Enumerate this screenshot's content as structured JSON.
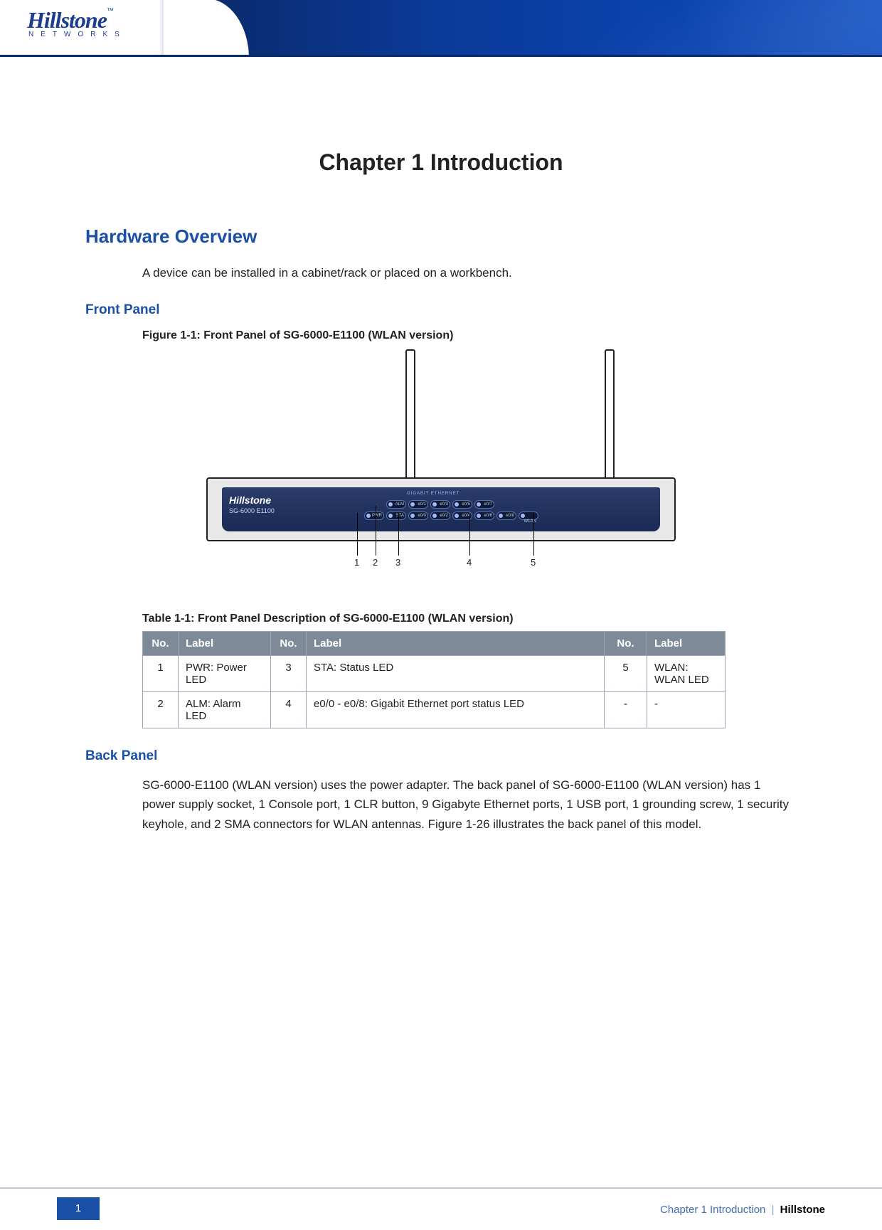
{
  "header": {
    "logo_word": "Hillstone",
    "logo_tm": "™",
    "logo_sub": "NETWORKS"
  },
  "main": {
    "chapter_title": "Chapter 1 Introduction",
    "h2_hardware": "Hardware Overview",
    "intro_text": "A device can be installed in a cabinet/rack or placed on a workbench.",
    "h3_front": "Front Panel",
    "fig_caption": "Figure 1-1: Front Panel of SG-6000-E1100 (WLAN version)",
    "device": {
      "brand": "Hillstone",
      "model_line": "SG-6000   E1100",
      "row1": [
        "ALM",
        "e0/1",
        "e0/3",
        "e0/5",
        "e0/7"
      ],
      "row2": [
        "PWR",
        "STA",
        "e0/0",
        "e0/2",
        "e0/4",
        "e0/6",
        "e0/8",
        "WLAN"
      ],
      "led_header": "GIGABIT ETHERNET",
      "callouts": [
        "1",
        "2",
        "3",
        "4",
        "5"
      ]
    },
    "tbl_caption": "Table 1-1: Front Panel Description of SG-6000-E1100 (WLAN version)",
    "table": {
      "headers": [
        "No.",
        "Label",
        "No.",
        "Label",
        "No.",
        "Label"
      ],
      "rows": [
        [
          "1",
          "PWR: Power LED",
          "3",
          "STA: Status LED",
          "5",
          "WLAN: WLAN LED"
        ],
        [
          "2",
          "ALM: Alarm LED",
          "4",
          "e0/0 - e0/8: Gigabit Ethernet port status LED",
          "-",
          "-"
        ]
      ]
    },
    "h3_back": "Back Panel",
    "back_text": "SG-6000-E1100 (WLAN version) uses the power adapter. The back panel of SG-6000-E1100 (WLAN version) has 1 power supply socket, 1 Console port, 1 CLR button, 9 Gigabyte Ethernet ports, 1 USB port, 1 grounding screw, 1 security keyhole, and 2 SMA connectors for WLAN antennas. Figure 1-26 illustrates the back panel of this model."
  },
  "footer": {
    "page_num": "1",
    "crumb_chapter": "Chapter 1 Introduction",
    "crumb_brand": "Hillstone"
  }
}
